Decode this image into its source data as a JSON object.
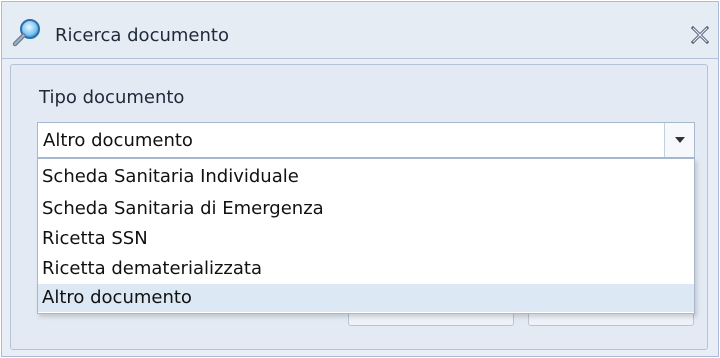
{
  "dialog": {
    "title": "Ricerca documento",
    "icon": "magnifier-icon",
    "close_icon": "close-icon"
  },
  "form": {
    "tipo_label": "Tipo documento",
    "tipo_selected": "Altro documento",
    "dropdown_arrow_icon": "chevron-down-icon",
    "options": [
      "Scheda Sanitaria Individuale",
      "Scheda Sanitaria di Emergenza",
      "Ricetta SSN",
      "Ricetta dematerializzata",
      "Altro documento"
    ],
    "highlighted_option": "Altro documento"
  },
  "colors": {
    "titlebar": "#e6ecf4",
    "highlight": "#dde8f5",
    "border": "#a7b8cf"
  }
}
